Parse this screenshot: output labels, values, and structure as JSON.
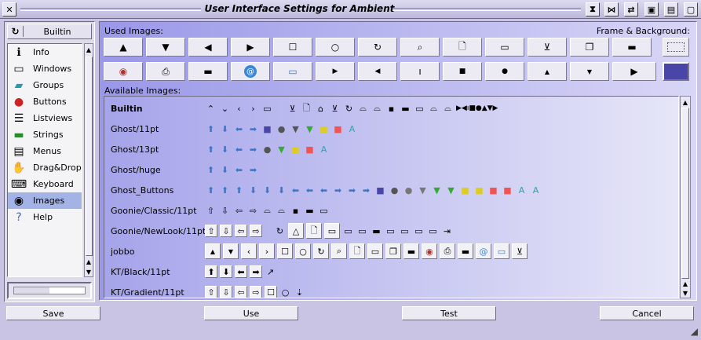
{
  "window": {
    "title": "User Interface Settings for Ambient",
    "buttons": [
      "close",
      "iconify",
      "maximize",
      "shade",
      "sticky",
      "resize"
    ]
  },
  "sidebar": {
    "builtin_label": "Builtin",
    "items": [
      {
        "label": "Info",
        "icon": "info-icon"
      },
      {
        "label": "Windows",
        "icon": "windows-icon"
      },
      {
        "label": "Groups",
        "icon": "groups-icon"
      },
      {
        "label": "Buttons",
        "icon": "buttons-icon"
      },
      {
        "label": "Listviews",
        "icon": "listviews-icon"
      },
      {
        "label": "Strings",
        "icon": "strings-icon"
      },
      {
        "label": "Menus",
        "icon": "menus-icon"
      },
      {
        "label": "Drag&Drop",
        "icon": "drag-drop-icon"
      },
      {
        "label": "Keyboard",
        "icon": "keyboard-icon"
      },
      {
        "label": "Images",
        "icon": "images-icon",
        "selected": true
      },
      {
        "label": "Help",
        "icon": "help-icon"
      }
    ]
  },
  "main": {
    "used_images_label": "Used Images:",
    "frame_background_label": "Frame & Background:",
    "available_images_label": "Available Images:",
    "available_rows": [
      {
        "name": "Builtin"
      },
      {
        "name": "Ghost/11pt"
      },
      {
        "name": "Ghost/13pt"
      },
      {
        "name": "Ghost/huge"
      },
      {
        "name": "Ghost_Buttons"
      },
      {
        "name": "Goonie/Classic/11pt"
      },
      {
        "name": "Goonie/NewLook/11pt"
      },
      {
        "name": "jobbo"
      },
      {
        "name": "KT/Black/11pt"
      },
      {
        "name": "KT/Gradient/11pt"
      }
    ]
  },
  "bottom": {
    "save": "Save",
    "use": "Use",
    "test": "Test",
    "cancel": "Cancel"
  },
  "colors": {
    "accent": "#4a46a8",
    "selection": "#a3b3e5"
  }
}
